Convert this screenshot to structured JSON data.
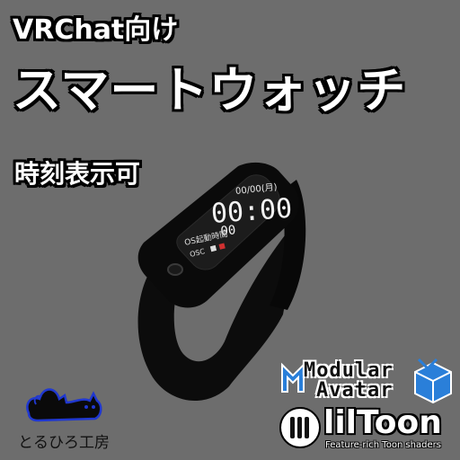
{
  "header": {
    "subtitle": "VRChat向け",
    "title": "スマートウォッチ",
    "feature": "時刻表示可"
  },
  "watch": {
    "date": "00/00(月)",
    "time": "00:00",
    "seconds": "00",
    "status_label": "OS起動時間",
    "status_row_prefix": "OSC",
    "band_color": "#0a0a0a",
    "screen_color": "#1b1b1b"
  },
  "branding": {
    "studio_name": "とるひろ工房",
    "modular_avatar_line1": "Modular",
    "modular_avatar_line2": "Avatar",
    "liltoon_name": "lilToon",
    "liltoon_tagline": "Feature-rich Toon shaders",
    "modular_avatar_accent": "#2a7fd9"
  }
}
